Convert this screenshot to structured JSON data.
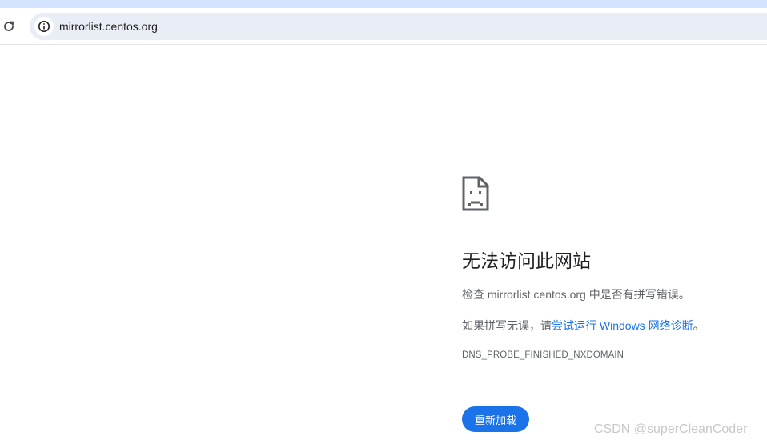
{
  "browser": {
    "url": "mirrorlist.centos.org",
    "icons": {
      "reload": "reload-icon",
      "site_info": "info-icon"
    }
  },
  "error_page": {
    "icon": "sad-document-icon",
    "title": "无法访问此网站",
    "check_prefix": "检查 ",
    "check_host": "mirrorlist.centos.org",
    "check_suffix": " 中是否有拼写错误。",
    "hint_prefix": "如果拼写无误，请",
    "hint_link": "尝试运行 Windows 网络诊断",
    "hint_suffix": "。",
    "error_code": "DNS_PROBE_FINISHED_NXDOMAIN",
    "reload_label": "重新加载",
    "accent_color": "#1a73e8"
  },
  "watermark": {
    "text": "CSDN @superCleanCoder"
  }
}
